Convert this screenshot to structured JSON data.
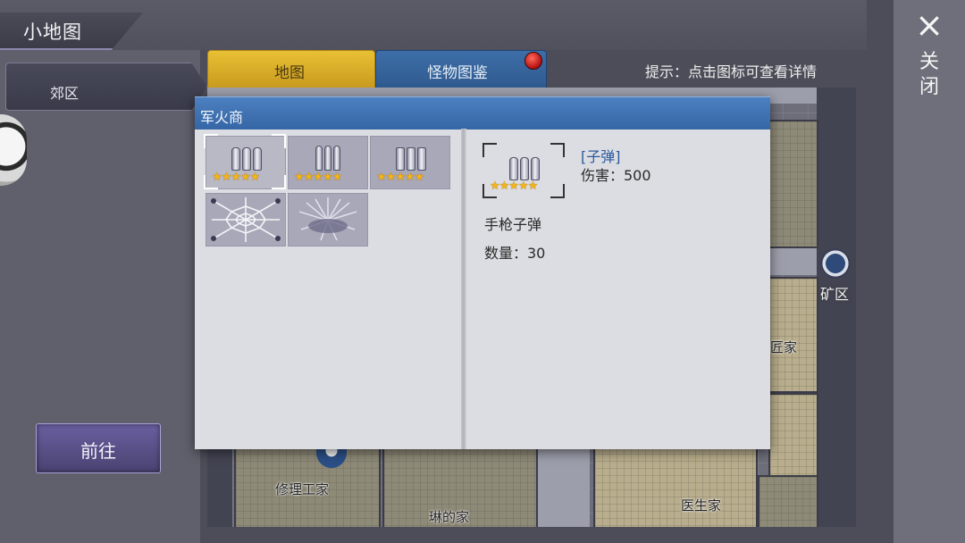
{
  "window": {
    "title": "小地图",
    "close_icon": "×",
    "close_label": "关闭"
  },
  "left": {
    "area_item": "郊区",
    "goto_button": "前往"
  },
  "tabs": [
    {
      "label": "地图",
      "active": true
    },
    {
      "label": "怪物图鉴",
      "active": false,
      "badge": "red-dot"
    }
  ],
  "hint": "提示：点击图标可查看详情",
  "map": {
    "exit_label": "矿区",
    "labels": {
      "repair": "修理工家",
      "lin": "琳的家",
      "doctor": "医生家",
      "crafter": "匠家"
    }
  },
  "dialog": {
    "title": "军火商",
    "items": [
      {
        "name": "bullet-pack-a",
        "stars": "★★★★★",
        "selected": true
      },
      {
        "name": "bullet-pack-b",
        "stars": "★★★★★",
        "selected": false
      },
      {
        "name": "bullet-pack-c",
        "stars": "★★★★★",
        "selected": false
      },
      {
        "name": "spider-web",
        "stars": "",
        "selected": false
      },
      {
        "name": "spike-trap",
        "stars": "",
        "selected": false
      }
    ],
    "detail": {
      "stars": "★★★★★",
      "name": "[子弹]",
      "damage": "伤害：500",
      "description": "手枪子弹",
      "quantity": "数量：30"
    }
  },
  "colors": {
    "tab_active": "#e0b52d",
    "tab_inactive": "#346398",
    "title_bar": "#4277b8",
    "star": "#f5b417"
  }
}
